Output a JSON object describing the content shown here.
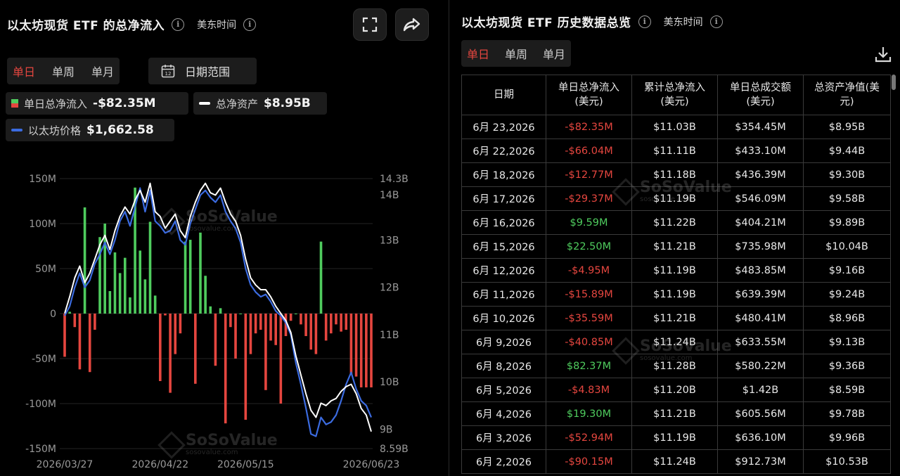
{
  "left": {
    "title": "以太坊现货 ETF 的总净流入",
    "tz": "美东时间",
    "tabs": [
      {
        "label": "单日",
        "active": true
      },
      {
        "label": "单周",
        "active": false
      },
      {
        "label": "单月",
        "active": false
      }
    ],
    "date_range_label": "日期范围",
    "calendar_day": "12",
    "stats": {
      "daily_label": "单日总净流入",
      "daily_value": "-$82.35M",
      "assets_label": "总净资产",
      "assets_value": "$8.95B",
      "price_label": "以太坊价格",
      "price_value": "$1,662.58"
    },
    "watermark": {
      "name": "SoSoValue",
      "url": "sosovalue.com"
    }
  },
  "right": {
    "title": "以太坊现货 ETF 历史数据总览",
    "tz": "美东时间",
    "tabs": [
      {
        "label": "单日",
        "active": true
      },
      {
        "label": "单周",
        "active": false
      },
      {
        "label": "单月",
        "active": false
      }
    ],
    "columns": [
      "日期",
      "单日总净流入\n(美元)",
      "累计总净流入\n(美元)",
      "单日总成交额\n(美元)",
      "总资产净值(美\n元)"
    ],
    "rows": [
      {
        "date": "6月 23,2026",
        "flow": "-$82.35M",
        "sign": "neg",
        "cum": "$11.03B",
        "vol": "$354.45M",
        "nav": "$8.95B"
      },
      {
        "date": "6月 22,2026",
        "flow": "-$66.04M",
        "sign": "neg",
        "cum": "$11.11B",
        "vol": "$433.10M",
        "nav": "$9.44B"
      },
      {
        "date": "6月 18,2026",
        "flow": "-$12.77M",
        "sign": "neg",
        "cum": "$11.18B",
        "vol": "$436.39M",
        "nav": "$9.30B"
      },
      {
        "date": "6月 17,2026",
        "flow": "-$29.37M",
        "sign": "neg",
        "cum": "$11.19B",
        "vol": "$546.09M",
        "nav": "$9.58B"
      },
      {
        "date": "6月 16,2026",
        "flow": "$9.59M",
        "sign": "pos",
        "cum": "$11.22B",
        "vol": "$404.21M",
        "nav": "$9.89B"
      },
      {
        "date": "6月 15,2026",
        "flow": "$22.50M",
        "sign": "pos",
        "cum": "$11.21B",
        "vol": "$735.98M",
        "nav": "$10.04B"
      },
      {
        "date": "6月 12,2026",
        "flow": "-$4.95M",
        "sign": "neg",
        "cum": "$11.19B",
        "vol": "$483.85M",
        "nav": "$9.16B"
      },
      {
        "date": "6月 11,2026",
        "flow": "-$15.89M",
        "sign": "neg",
        "cum": "$11.19B",
        "vol": "$639.39M",
        "nav": "$9.24B"
      },
      {
        "date": "6月 10,2026",
        "flow": "-$35.59M",
        "sign": "neg",
        "cum": "$11.21B",
        "vol": "$480.41M",
        "nav": "$8.96B"
      },
      {
        "date": "6月 9,2026",
        "flow": "-$40.85M",
        "sign": "neg",
        "cum": "$11.24B",
        "vol": "$633.55M",
        "nav": "$9.13B"
      },
      {
        "date": "6月 8,2026",
        "flow": "$82.37M",
        "sign": "pos",
        "cum": "$11.28B",
        "vol": "$580.22M",
        "nav": "$9.36B"
      },
      {
        "date": "6月 5,2026",
        "flow": "-$4.83M",
        "sign": "neg",
        "cum": "$11.20B",
        "vol": "$1.42B",
        "nav": "$8.59B"
      },
      {
        "date": "6月 4,2026",
        "flow": "$19.30M",
        "sign": "pos",
        "cum": "$11.21B",
        "vol": "$605.56M",
        "nav": "$9.78B"
      },
      {
        "date": "6月 3,2026",
        "flow": "-$52.94M",
        "sign": "neg",
        "cum": "$11.19B",
        "vol": "$636.10M",
        "nav": "$9.96B"
      },
      {
        "date": "6月 2,2026",
        "flow": "-$90.15M",
        "sign": "neg",
        "cum": "$11.24B",
        "vol": "$912.73M",
        "nav": "$10.53B"
      }
    ]
  },
  "colors": {
    "positive": "#4fcc5e",
    "negative": "#e5463f",
    "price_line": "#3b6be0",
    "assets_line": "#ffffff",
    "accent": "#e5463f"
  },
  "icons": {
    "fullscreen": "fullscreen-icon",
    "share": "share-icon",
    "download": "download-icon",
    "calendar": "calendar-icon",
    "info": "info-icon"
  },
  "chart_data": {
    "type": "bar",
    "title": "",
    "xlabel": "",
    "ylabel": "",
    "x_tick_labels": [
      "2026/03/27",
      "2026/04/22",
      "2026/05/15",
      "2026/06/23"
    ],
    "x_tick_index": [
      0,
      19,
      36,
      61
    ],
    "ylim": [
      -150,
      150
    ],
    "y_ticks": [
      150,
      100,
      50,
      0,
      -50,
      -100,
      -150
    ],
    "y_tick_labels": [
      "150M",
      "100M",
      "50M",
      "0",
      "-50M",
      "-100M",
      "-150M"
    ],
    "y2lim": [
      8.59,
      14.3
    ],
    "y2_ticks": [
      14.3,
      14,
      13,
      12,
      11,
      10,
      9,
      8.59
    ],
    "y2_tick_labels": [
      "14.3B",
      "14B",
      "13B",
      "12B",
      "11B",
      "10B",
      "9B",
      "8.59B"
    ],
    "grid": true,
    "series": [
      {
        "name": "单日总净流入",
        "kind": "bar",
        "axis": "left",
        "values": [
          -48,
          2,
          -15,
          -62,
          118,
          -65,
          -18,
          85,
          100,
          25,
          68,
          45,
          62,
          18,
          140,
          70,
          38,
          102,
          20,
          -75,
          -2,
          -88,
          -45,
          -22,
          80,
          82,
          -78,
          90,
          42,
          8,
          -58,
          6,
          -122,
          -15,
          -50,
          0,
          -118,
          -45,
          -22,
          -18,
          -85,
          -30,
          -35,
          -100,
          -25,
          -8,
          0,
          -12,
          -25,
          -40,
          -45,
          80,
          -30,
          -22,
          -12,
          -20,
          -18,
          -68,
          -70,
          -82,
          -82,
          -82
        ]
      },
      {
        "name": "总净资产",
        "kind": "line",
        "axis": "right",
        "values": [
          11.45,
          11.8,
          12.2,
          12.45,
          12.1,
          12.3,
          12.6,
          12.9,
          13.1,
          12.8,
          13.2,
          13.5,
          13.7,
          13.55,
          13.85,
          14.05,
          13.8,
          14.2,
          13.6,
          13.5,
          13.25,
          13.4,
          13.55,
          13.2,
          13.05,
          13.5,
          13.8,
          14.05,
          14.2,
          14.0,
          13.95,
          14.1,
          13.8,
          13.55,
          13.4,
          13.1,
          12.6,
          12.2,
          12.05,
          11.95,
          11.95,
          11.8,
          11.6,
          11.45,
          11.3,
          11.05,
          10.55,
          10.15,
          9.75,
          9.4,
          9.25,
          9.55,
          9.5,
          9.6,
          9.65,
          9.8,
          9.9,
          9.95,
          9.75,
          9.44,
          9.3,
          8.95
        ]
      },
      {
        "name": "以太坊价格",
        "kind": "line",
        "axis": "right",
        "values": [
          11.4,
          11.6,
          12.0,
          12.3,
          12.0,
          12.15,
          12.5,
          12.7,
          12.95,
          12.7,
          13.0,
          13.4,
          13.6,
          13.3,
          13.7,
          14.1,
          13.6,
          14.05,
          13.4,
          13.3,
          13.15,
          13.2,
          13.4,
          13.0,
          12.9,
          13.35,
          13.65,
          13.95,
          14.05,
          13.9,
          13.8,
          13.95,
          13.6,
          13.4,
          13.25,
          12.95,
          12.4,
          12.05,
          11.9,
          11.8,
          11.85,
          11.7,
          11.5,
          11.4,
          11.25,
          11.0,
          10.4,
          9.95,
          9.45,
          8.9,
          8.85,
          9.25,
          9.1,
          9.15,
          9.3,
          9.6,
          9.95,
          10.2,
          9.85,
          9.6,
          9.5,
          9.25
        ]
      }
    ]
  }
}
